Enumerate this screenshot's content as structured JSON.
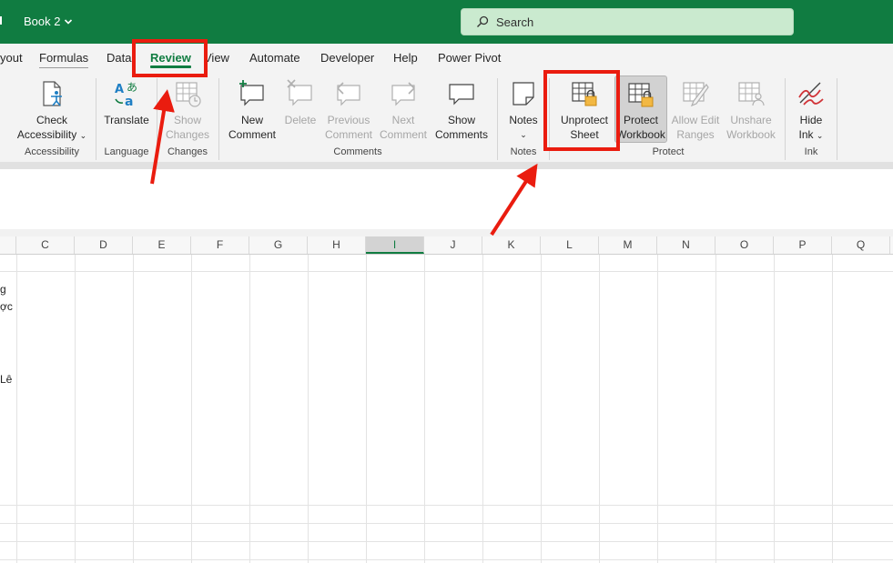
{
  "title_bar": {
    "doc_title": "Book 2",
    "search_placeholder": "Search",
    "icons": [
      "chevron-down-icon",
      "search-icon"
    ]
  },
  "tabs": [
    {
      "label": "yout"
    },
    {
      "label": "Formulas"
    },
    {
      "label": "Data"
    },
    {
      "label": "Review",
      "active": true
    },
    {
      "label": "View"
    },
    {
      "label": "Automate"
    },
    {
      "label": "Developer"
    },
    {
      "label": "Help"
    },
    {
      "label": "Power Pivot"
    }
  ],
  "ribbon": {
    "accessibility": {
      "line1": "Check",
      "line2": "Accessibility",
      "group": "Accessibility"
    },
    "language": {
      "label": "Translate",
      "group": "Language"
    },
    "changes": {
      "line1": "Show",
      "line2": "Changes",
      "group": "Changes"
    },
    "comments": {
      "new": {
        "line1": "New",
        "line2": "Comment"
      },
      "delete": {
        "line1": "Delete"
      },
      "previous": {
        "line1": "Previous",
        "line2": "Comment"
      },
      "next": {
        "line1": "Next",
        "line2": "Comment"
      },
      "show": {
        "line1": "Show",
        "line2": "Comments"
      },
      "group": "Comments"
    },
    "notes": {
      "label": "Notes",
      "group": "Notes"
    },
    "protect": {
      "unprotect_sheet": {
        "line1": "Unprotect",
        "line2": "Sheet"
      },
      "protect_workbook": {
        "line1": "Protect",
        "line2": "Workbook"
      },
      "allow_edit": {
        "line1": "Allow Edit",
        "line2": "Ranges"
      },
      "unshare": {
        "line1": "Unshare",
        "line2": "Workbook"
      },
      "group": "Protect"
    },
    "ink": {
      "line1": "Hide",
      "line2": "Ink",
      "group": "Ink"
    }
  },
  "grid": {
    "columns": [
      "C",
      "D",
      "E",
      "F",
      "G",
      "H",
      "I",
      "J",
      "K",
      "L",
      "M",
      "N",
      "O",
      "P",
      "Q"
    ],
    "selected_column": "I",
    "cell_fragments": [
      "g",
      "ợc",
      "Lê"
    ]
  },
  "colors": {
    "brand_green": "#107c41",
    "annotation_red": "#ea1c0f"
  }
}
